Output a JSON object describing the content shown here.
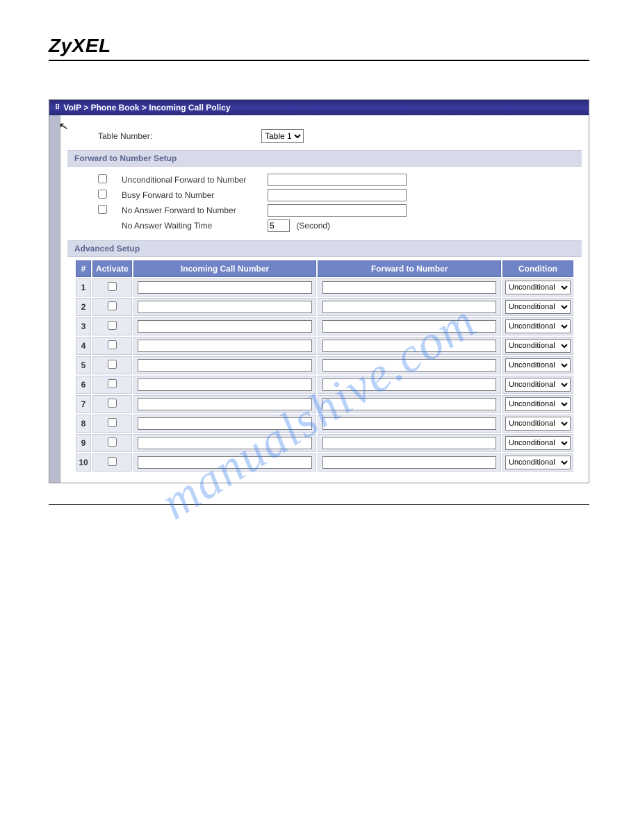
{
  "brand": "ZyXEL",
  "breadcrumb": "VoIP > Phone Book > Incoming Call Policy",
  "top": {
    "table_number_label": "Table Number:",
    "table_number_value": "Table 1"
  },
  "sections": {
    "forward_title": "Forward to Number Setup",
    "advanced_title": "Advanced Setup"
  },
  "forward": {
    "uncond_label": "Unconditional Forward to Number",
    "uncond_checked": false,
    "uncond_value": "",
    "busy_label": "Busy Forward to Number",
    "busy_checked": false,
    "busy_value": "",
    "noans_label": "No Answer Forward to Number",
    "noans_checked": false,
    "noans_value": "",
    "wait_label": "No Answer Waiting Time",
    "wait_value": "5",
    "wait_unit": "(Second)"
  },
  "adv_table": {
    "headers": {
      "idx": "#",
      "activate": "Activate",
      "incoming": "Incoming Call Number",
      "forward": "Forward to Number",
      "condition": "Condition"
    },
    "rows": [
      {
        "idx": "1",
        "activate": false,
        "incoming": "",
        "forward": "",
        "condition": "Unconditional"
      },
      {
        "idx": "2",
        "activate": false,
        "incoming": "",
        "forward": "",
        "condition": "Unconditional"
      },
      {
        "idx": "3",
        "activate": false,
        "incoming": "",
        "forward": "",
        "condition": "Unconditional"
      },
      {
        "idx": "4",
        "activate": false,
        "incoming": "",
        "forward": "",
        "condition": "Unconditional"
      },
      {
        "idx": "5",
        "activate": false,
        "incoming": "",
        "forward": "",
        "condition": "Unconditional"
      },
      {
        "idx": "6",
        "activate": false,
        "incoming": "",
        "forward": "",
        "condition": "Unconditional"
      },
      {
        "idx": "7",
        "activate": false,
        "incoming": "",
        "forward": "",
        "condition": "Unconditional"
      },
      {
        "idx": "8",
        "activate": false,
        "incoming": "",
        "forward": "",
        "condition": "Unconditional"
      },
      {
        "idx": "9",
        "activate": false,
        "incoming": "",
        "forward": "",
        "condition": "Unconditional"
      },
      {
        "idx": "10",
        "activate": false,
        "incoming": "",
        "forward": "",
        "condition": "Unconditional"
      }
    ]
  },
  "watermark": "manualshive.com"
}
